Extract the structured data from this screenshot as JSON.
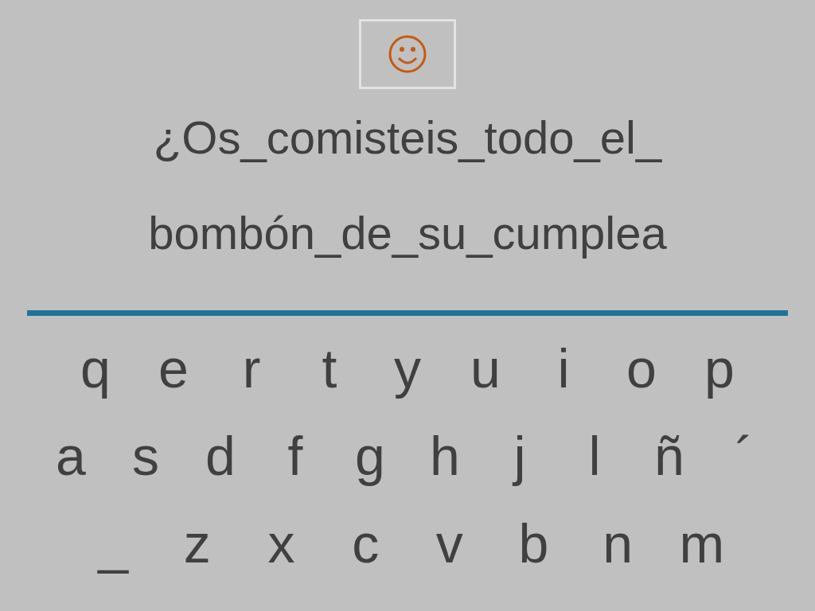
{
  "sentence_lines": [
    "¿Os_comisteis_todo_el_",
    "bombón_de_su_cumplea"
  ],
  "keyboard_rows": [
    [
      "q",
      "e",
      "r",
      "t",
      "y",
      "u",
      "i",
      "o",
      "p"
    ],
    [
      "a",
      "s",
      "d",
      "f",
      "g",
      "h",
      "j",
      "l",
      "ñ",
      "´"
    ],
    [
      "_",
      "z",
      "x",
      "c",
      "v",
      "b",
      "n",
      "m"
    ]
  ]
}
